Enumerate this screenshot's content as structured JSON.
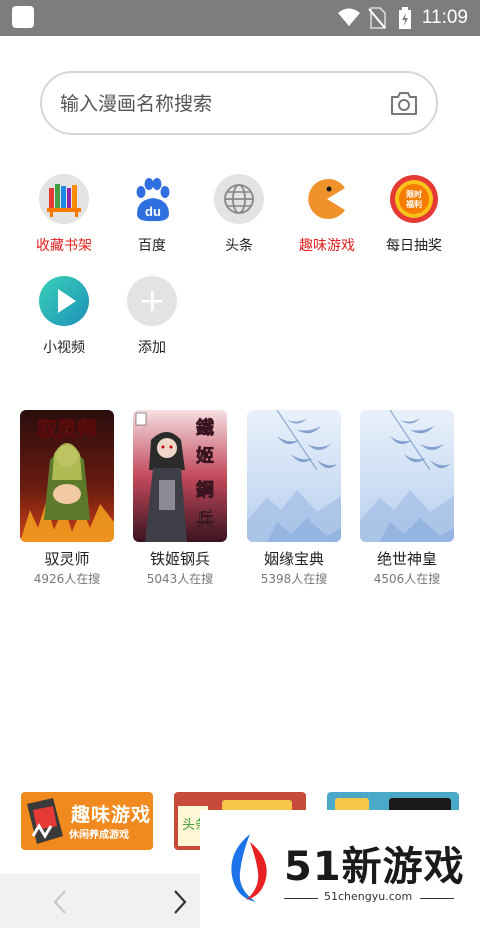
{
  "status_bar": {
    "time": "11:09",
    "icons": [
      "wifi-icon",
      "no-sim-icon",
      "battery-charging-icon"
    ]
  },
  "search": {
    "placeholder": "输入漫画名称搜索",
    "value": "",
    "icon": "camera-icon"
  },
  "shortcuts": [
    {
      "label": "收藏书架",
      "icon": "bookshelf-icon",
      "highlight": true
    },
    {
      "label": "百度",
      "icon": "baidu-paw-icon",
      "highlight": false
    },
    {
      "label": "头条",
      "icon": "globe-icon",
      "highlight": false
    },
    {
      "label": "趣味游戏",
      "icon": "pacman-icon",
      "highlight": true
    },
    {
      "label": "每日抽奖",
      "icon": "lottery-badge-icon",
      "highlight": false,
      "badge_text": "限时福利"
    },
    {
      "label": "小视频",
      "icon": "play-icon",
      "highlight": false
    },
    {
      "label": "添加",
      "icon": "plus-icon",
      "highlight": false
    }
  ],
  "comics": [
    {
      "title": "驭灵师",
      "searches": "4926人在搜",
      "cover_text": "驭灵师"
    },
    {
      "title": "铁姬钢兵",
      "searches": "5043人在搜",
      "cover_text": "鐵姬鋼兵"
    },
    {
      "title": "姻缘宝典",
      "searches": "5398人在搜",
      "cover_text": ""
    },
    {
      "title": "绝世神皇",
      "searches": "4506人在搜",
      "cover_text": ""
    }
  ],
  "banners": [
    {
      "title": "趣味游戏",
      "subtitle": "休闲养成游戏"
    },
    {
      "title": "头条",
      "subtitle": ""
    },
    {
      "title": "",
      "subtitle": ""
    }
  ],
  "watermark": {
    "text": "51新游戏",
    "domain": "51chengyu.com"
  },
  "colors": {
    "status_bar": "#7d7d7d",
    "highlight_red": "#e02020",
    "banner_orange": "#f08a1e"
  }
}
